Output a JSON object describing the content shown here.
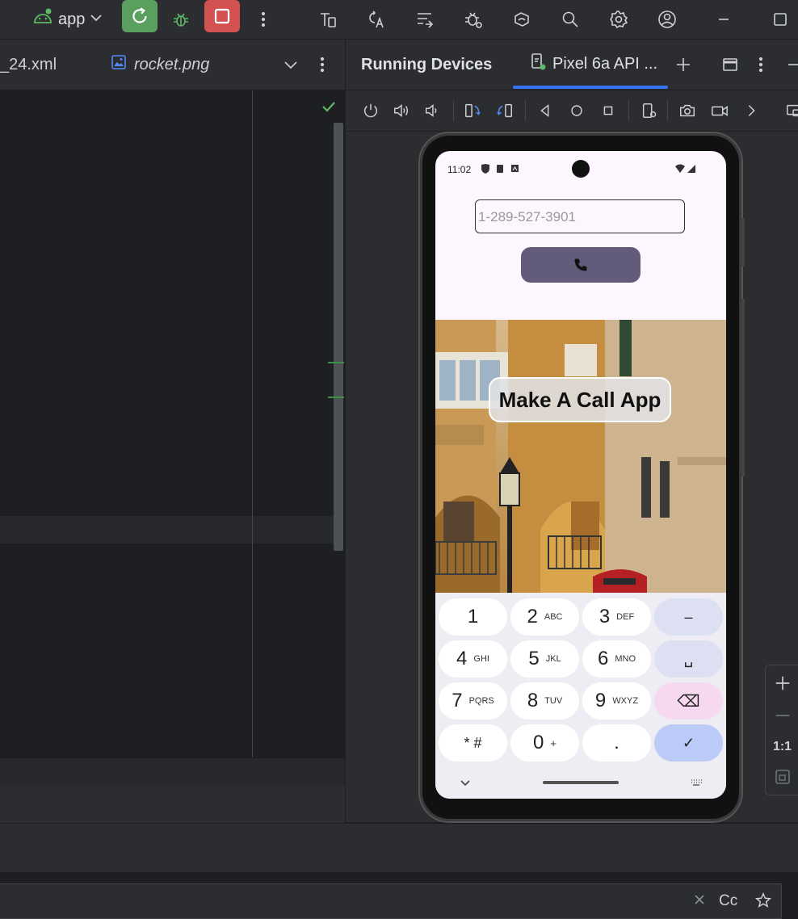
{
  "toolbar": {
    "run_config_label": "app",
    "icons": [
      "android-icon",
      "rerun-icon",
      "debug-icon",
      "stop-icon",
      "more-icon",
      "device-manager-icon",
      "translate-icon",
      "layout-inspector-icon",
      "bug-settings-icon",
      "sync-icon",
      "search-icon",
      "settings-icon",
      "account-icon",
      "minimize-icon",
      "maximize-icon"
    ]
  },
  "editor": {
    "tabs": [
      {
        "label": "_24.xml"
      },
      {
        "label": "rocket.png"
      }
    ]
  },
  "running_devices": {
    "title": "Running Devices",
    "device_tab": "Pixel 6a API ..."
  },
  "phone": {
    "status_time": "11:02",
    "phone_input_placeholder": "1-289-527-3901",
    "title": "Make A Call App",
    "keyboard": {
      "rows": [
        [
          {
            "num": "1",
            "sub": ""
          },
          {
            "num": "2",
            "sub": "ABC"
          },
          {
            "num": "3",
            "sub": "DEF"
          },
          {
            "num": "–",
            "sub": ""
          }
        ],
        [
          {
            "num": "4",
            "sub": "GHI"
          },
          {
            "num": "5",
            "sub": "JKL"
          },
          {
            "num": "6",
            "sub": "MNO"
          },
          {
            "num": "␣",
            "sub": ""
          }
        ],
        [
          {
            "num": "7",
            "sub": "PQRS"
          },
          {
            "num": "8",
            "sub": "TUV"
          },
          {
            "num": "9",
            "sub": "WXYZ"
          },
          {
            "num": "⌫",
            "sub": ""
          }
        ],
        [
          {
            "num": "* #",
            "sub": ""
          },
          {
            "num": "0",
            "sub": "+"
          },
          {
            "num": ".",
            "sub": ""
          },
          {
            "num": "✓",
            "sub": ""
          }
        ]
      ]
    }
  },
  "zoom": {
    "one_to_one": "1:1"
  },
  "find": {
    "case_label": "Cc"
  },
  "colors": {
    "accent": "#3574f0",
    "run_green": "#5b9f5e",
    "stop_red": "#d25252",
    "call_button": "#625b7a"
  }
}
